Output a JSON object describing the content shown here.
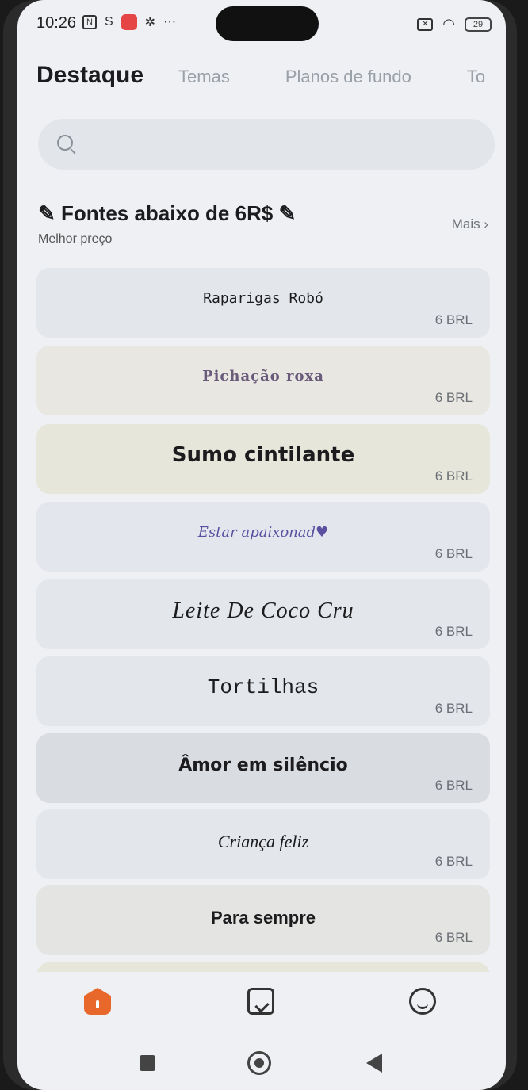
{
  "status_bar": {
    "time": "10:26",
    "icons": [
      "nfc-icon",
      "s-icon",
      "red-app-icon",
      "settings-gear-icon",
      "more-dots-icon"
    ],
    "battery": "29"
  },
  "tabs": [
    {
      "label": "Destaque",
      "active": true
    },
    {
      "label": "Temas",
      "active": false
    },
    {
      "label": "Planos de fundo",
      "active": false
    },
    {
      "label": "To",
      "active": false
    }
  ],
  "search": {
    "placeholder": ""
  },
  "section": {
    "title": "✎ Fontes abaixo de 6R$ ✎",
    "subtitle": "Melhor preço",
    "more_label": "Mais ›"
  },
  "fonts": [
    {
      "name": "Raparigas Robó",
      "price": "6 BRL",
      "bg": "#e2e5ea"
    },
    {
      "name": "Pichação roxa",
      "price": "6 BRL",
      "bg": "#e8e7e2"
    },
    {
      "name": "Sumo cintilante",
      "price": "6 BRL",
      "bg": "#e6e6da"
    },
    {
      "name": "Estar apaixonad♥",
      "price": "6 BRL",
      "bg": "#e4e6ee"
    },
    {
      "name": "Leite De Coco Cru",
      "price": "6 BRL",
      "bg": "#e3e6ea"
    },
    {
      "name": "Tortilhas",
      "price": "6 BRL",
      "bg": "#e3e6ea"
    },
    {
      "name": "Âmor em silêncio",
      "price": "6 BRL",
      "bg": "#d9dce1"
    },
    {
      "name": "Criança feliz",
      "price": "6 BRL",
      "bg": "#e3e6ea"
    },
    {
      "name": "Para sempre",
      "price": "6 BRL",
      "bg": "#e4e5e2"
    }
  ],
  "colors": {
    "accent": "#e8682c",
    "background": "#eef0f3"
  }
}
